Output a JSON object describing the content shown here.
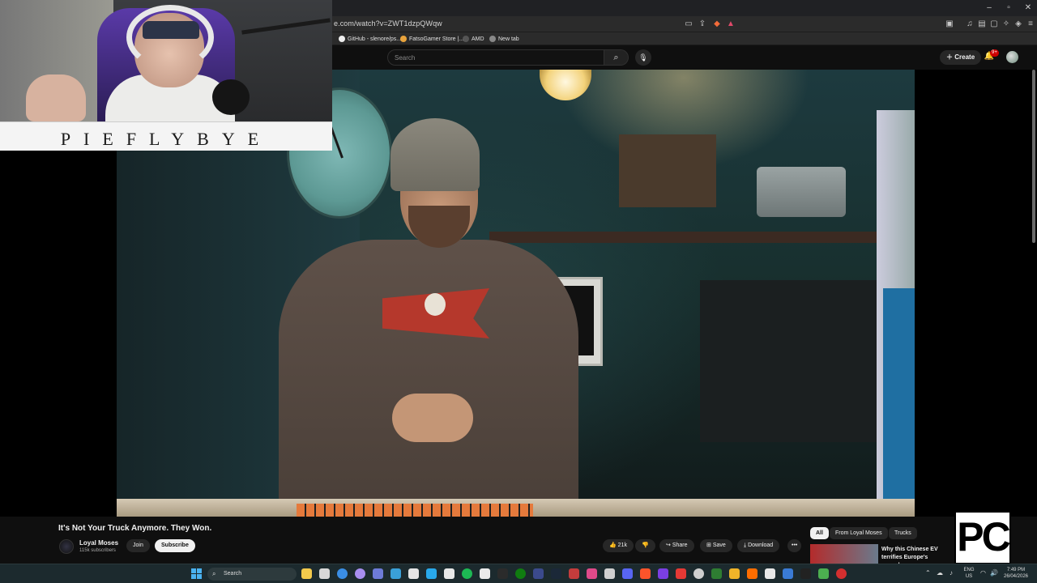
{
  "browser": {
    "url": "e.com/watch?v=ZWT1dzpQWqw",
    "bookmarks": [
      {
        "label": "GitHub - slenore/ps..."
      },
      {
        "label": "FatsoGamer Store |..."
      },
      {
        "label": "AMD"
      },
      {
        "label": "New tab"
      }
    ],
    "window_controls": {
      "minimize": "–",
      "maximize": "▫",
      "close": "✕"
    }
  },
  "youtube": {
    "search_placeholder": "Search",
    "create_label": "Create",
    "notification_count": "9+"
  },
  "facecam": {
    "name_banner": "PIEFLYBYE"
  },
  "video": {
    "title": "It's Not Your Truck Anymore. They Won.",
    "channel": {
      "name": "Loyal Moses",
      "subscribers": "115k subscribers"
    },
    "join_label": "Join",
    "subscribe_label": "Subscribe",
    "likes": "21k",
    "share_label": "Share",
    "save_label": "Save",
    "download_label": "Download",
    "more_label": "•••"
  },
  "recommendations": {
    "chips": [
      "All",
      "From Loyal Moses",
      "Trucks"
    ],
    "first_title": "Why this Chinese EV terrifies Europe's carmakers"
  },
  "overlay": {
    "logo_text": "PC"
  },
  "taskbar": {
    "search_label": "Search",
    "language": "ENG",
    "region": "US",
    "time": "7:49 PM",
    "date": "26/04/2026"
  },
  "colors": {
    "page_bg": "#0f0f0f",
    "accent_red": "#cc0000",
    "chip_active": "#f1f1f1",
    "taskbar_bg": "#1c2a2e"
  }
}
